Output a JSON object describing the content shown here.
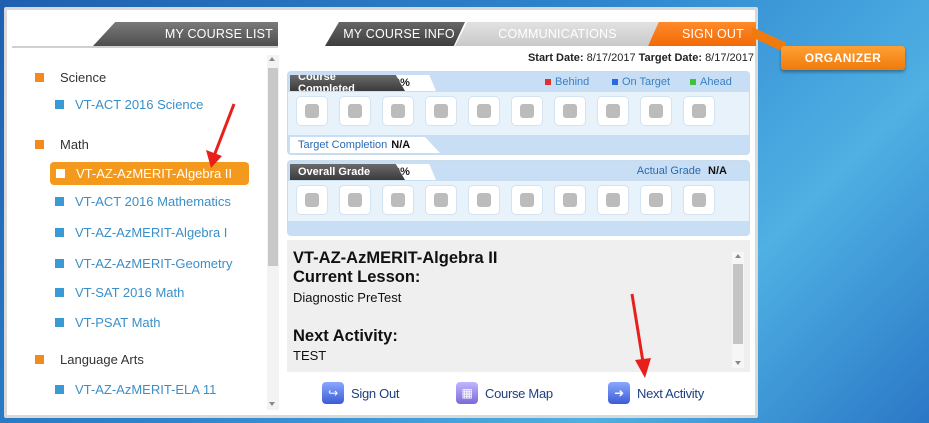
{
  "tabs": {
    "course_list": "MY COURSE LIST",
    "course_info": "MY COURSE INFO",
    "communications": "COMMUNICATIONS",
    "sign_out": "SIGN OUT"
  },
  "organizer": {
    "label": "ORGANIZER"
  },
  "sidebar": {
    "categories": [
      {
        "label": "Science",
        "courses": [
          "VT-ACT 2016 Science"
        ]
      },
      {
        "label": "Math",
        "courses": [
          "VT-AZ-AzMERIT-Algebra II",
          "VT-ACT 2016 Mathematics",
          "VT-AZ-AzMERIT-Algebra I",
          "VT-AZ-AzMERIT-Geometry",
          "VT-SAT 2016 Math",
          "VT-PSAT Math"
        ]
      },
      {
        "label": "Language Arts",
        "courses": [
          "VT-AZ-AzMERIT-ELA 11"
        ]
      }
    ],
    "selected_course": "VT-AZ-AzMERIT-Algebra II"
  },
  "dates": {
    "start_label": "Start Date:",
    "start_value": "8/17/2017",
    "target_label": "Target Date:",
    "target_value": "8/17/2017"
  },
  "progress": {
    "course_completed_label": "Course Completed",
    "course_completed_value": "0%",
    "legend": [
      {
        "label": "Behind",
        "color": "#e03030"
      },
      {
        "label": "On Target",
        "color": "#2a6ae0"
      },
      {
        "label": "Ahead",
        "color": "#3cc43c"
      }
    ],
    "target_completion_label": "Target Completion",
    "target_completion_value": "N/A",
    "overall_grade_label": "Overall Grade",
    "overall_grade_value": "0%",
    "actual_grade_label": "Actual Grade",
    "actual_grade_value": "N/A"
  },
  "lesson": {
    "course_title": "VT-AZ-AzMERIT-Algebra II",
    "current_lesson_label": "Current Lesson:",
    "current_lesson_value": "Diagnostic PreTest",
    "next_activity_label": "Next Activity:",
    "next_activity_value": "TEST"
  },
  "buttons": {
    "sign_out": "Sign Out",
    "course_map": "Course Map",
    "next_activity": "Next Activity"
  },
  "colors": {
    "accent_orange": "#f39a1e",
    "link_blue": "#3a8fc9",
    "annotation_red": "#e8201c"
  }
}
